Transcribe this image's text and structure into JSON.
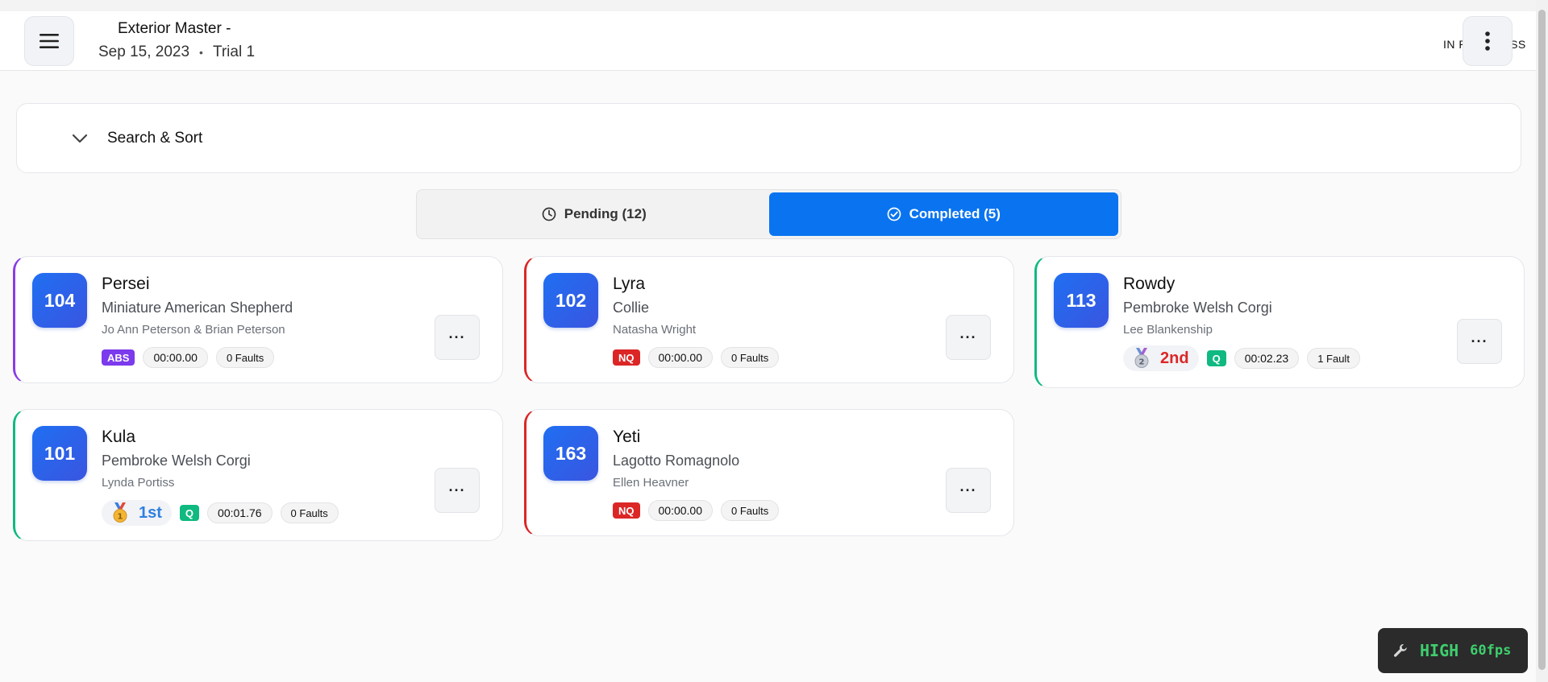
{
  "header": {
    "title": "Exterior Master -",
    "date": "Sep 15, 2023",
    "separator": "•",
    "trial": "Trial 1",
    "status": "IN PROGRESS"
  },
  "search": {
    "label": "Search & Sort"
  },
  "tabs": [
    {
      "label": "Pending (12)",
      "active": false
    },
    {
      "label": "Completed (5)",
      "active": true
    }
  ],
  "cards": [
    {
      "number": "104",
      "name": "Persei",
      "breed": "Miniature American Shepherd",
      "handler": "Jo Ann Peterson & Brian Peterson",
      "status": "ABS",
      "time": "00:00.00",
      "faults": "0 Faults",
      "accent": "#8b3ce6"
    },
    {
      "number": "102",
      "name": "Lyra",
      "breed": "Collie",
      "handler": "Natasha Wright",
      "status": "NQ",
      "time": "00:00.00",
      "faults": "0 Faults",
      "accent": "#dc2626"
    },
    {
      "number": "113",
      "name": "Rowdy",
      "breed": "Pembroke Welsh Corgi",
      "handler": "Lee Blankenship",
      "placement": "2nd",
      "medal": "2",
      "status": "Q",
      "time": "00:02.23",
      "faults": "1 Fault",
      "accent": "#10b981"
    },
    {
      "number": "101",
      "name": "Kula",
      "breed": "Pembroke Welsh Corgi",
      "handler": "Lynda Portiss",
      "placement": "1st",
      "medal": "1",
      "status": "Q",
      "time": "00:01.76",
      "faults": "0 Faults",
      "accent": "#10b981"
    },
    {
      "number": "163",
      "name": "Yeti",
      "breed": "Lagotto Romagnolo",
      "handler": "Ellen Heavner",
      "status": "NQ",
      "time": "00:00.00",
      "faults": "0 Faults",
      "accent": "#dc2626"
    }
  ],
  "card_menu_label": "···",
  "perf": {
    "level": "HIGH",
    "fps": "60fps",
    "icon": "wrench-icon"
  }
}
